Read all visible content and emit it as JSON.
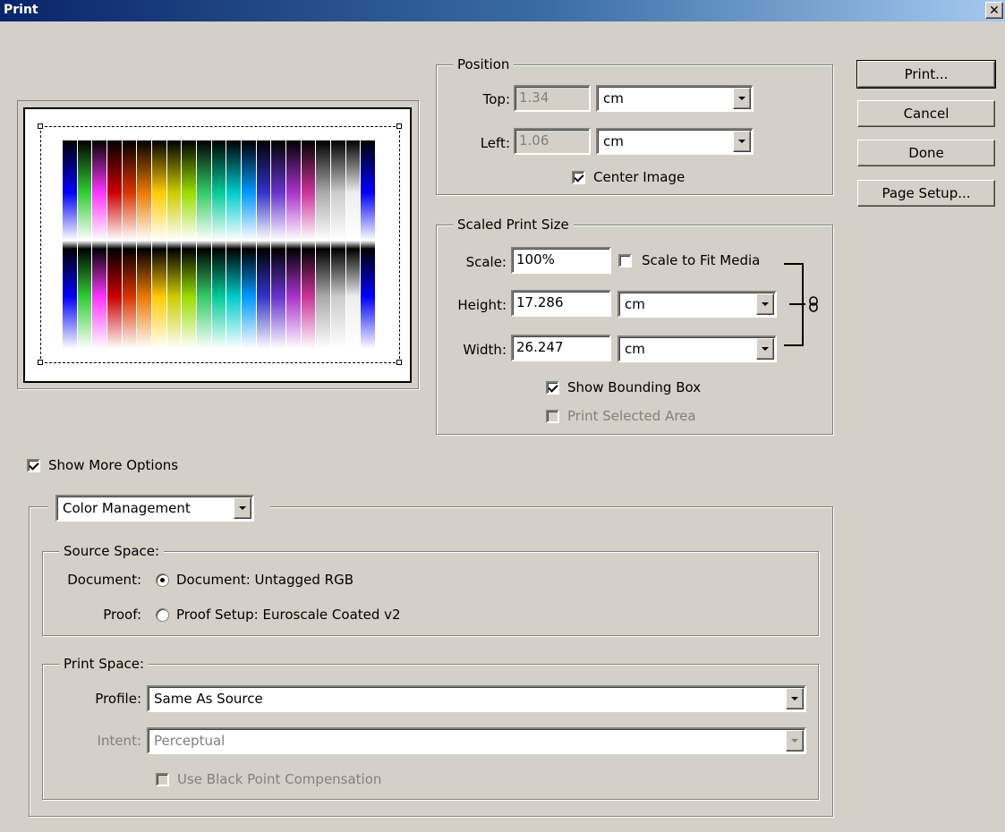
{
  "window": {
    "title": "Print"
  },
  "buttons": {
    "print": "Print...",
    "cancel": "Cancel",
    "done": "Done",
    "page_setup": "Page Setup..."
  },
  "position": {
    "legend": "Position",
    "top_label": "Top:",
    "top_value": "1.34",
    "top_unit": "cm",
    "left_label": "Left:",
    "left_value": "1.06",
    "left_unit": "cm",
    "center_image": "Center Image",
    "center_image_checked": true
  },
  "scaled": {
    "legend": "Scaled Print Size",
    "scale_label": "Scale:",
    "scale_value": "100%",
    "scale_to_fit": "Scale to Fit Media",
    "height_label": "Height:",
    "height_value": "17.286",
    "height_unit": "cm",
    "width_label": "Width:",
    "width_value": "26.247",
    "width_unit": "cm",
    "show_bounding_box": "Show Bounding Box",
    "print_selected_area": "Print Selected Area"
  },
  "more_options": {
    "label": "Show More Options",
    "checked": true,
    "mode": "Color Management"
  },
  "source_space": {
    "legend": "Source Space:",
    "document_label": "Document:",
    "document_option": "Document:  Untagged RGB",
    "proof_label": "Proof:",
    "proof_option": "Proof Setup:  Euroscale Coated v2"
  },
  "print_space": {
    "legend": "Print Space:",
    "profile_label": "Profile:",
    "profile_value": "Same As Source",
    "intent_label": "Intent:",
    "intent_value": "Perceptual",
    "bpc": "Use Black Point Compensation"
  },
  "preview": {
    "column_colors": [
      "#0000ff",
      "#33cc33",
      "#ff33ff",
      "#cc0000",
      "#dd3300",
      "#ee7700",
      "#ffcc00",
      "#cccc00",
      "#99dd00",
      "#33cc66",
      "#00cc99",
      "#00cccc",
      "#0099ff",
      "#3333cc",
      "#6633cc",
      "#aa33cc",
      "#cc3399",
      "#aaaaaa",
      "#cccccc",
      "#eeeeee",
      "#0000ff"
    ],
    "colors": {
      "title_bar_start": "#0a246a",
      "title_bar_end": "#a6caf0",
      "dialog_bg": "#d4d0c8"
    }
  }
}
